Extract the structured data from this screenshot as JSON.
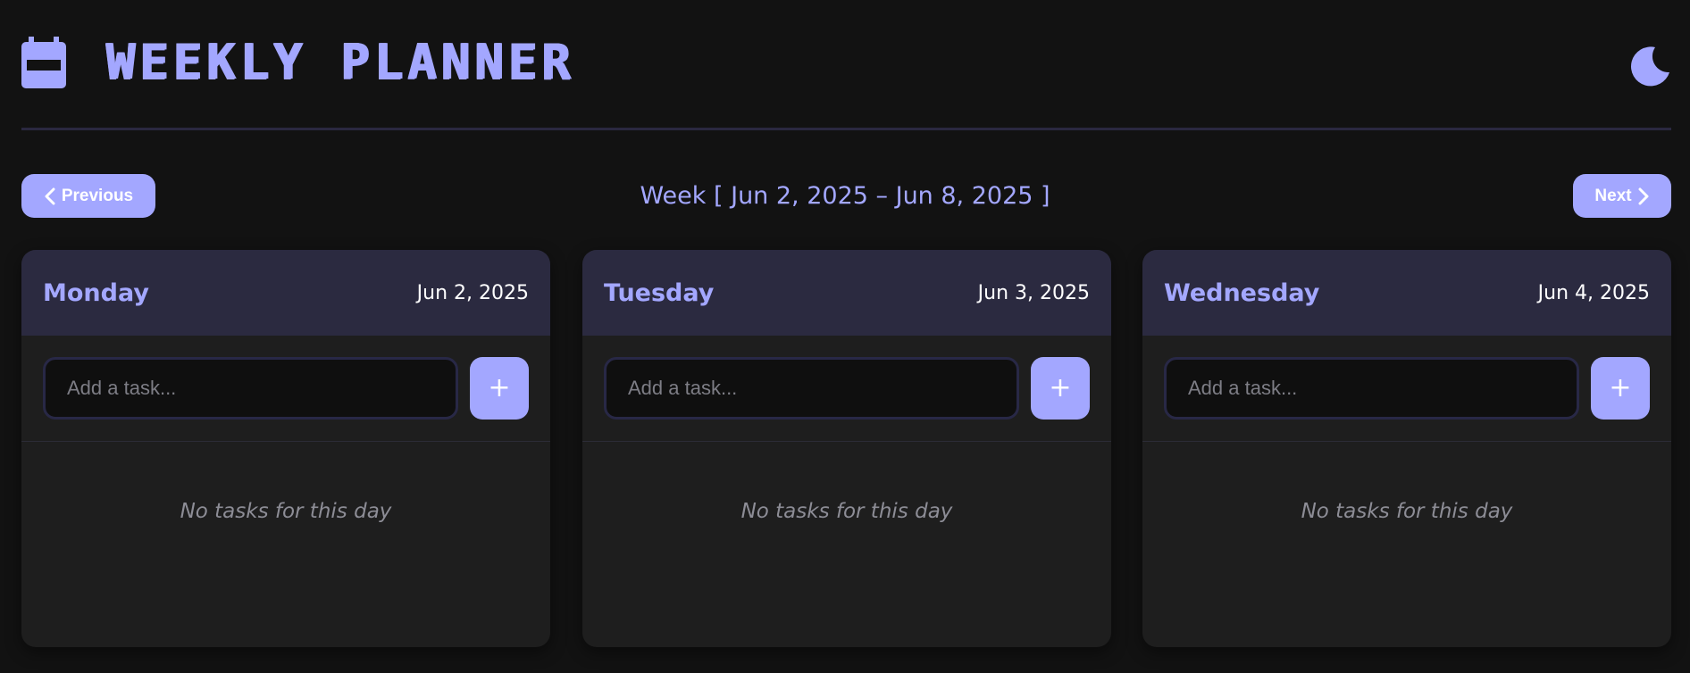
{
  "header": {
    "title": "WEEKLY PLANNER",
    "calendar_icon": "calendar-icon",
    "theme_icon": "moon-icon"
  },
  "nav": {
    "previous_label": "Previous",
    "next_label": "Next",
    "week_label": "Week [ Jun 2, 2025 – Jun 8, 2025 ]"
  },
  "days": [
    {
      "name": "Monday",
      "date": "Jun 2, 2025",
      "placeholder": "Add a task...",
      "add_label": "+",
      "empty_text": "No tasks for this day"
    },
    {
      "name": "Tuesday",
      "date": "Jun 3, 2025",
      "placeholder": "Add a task...",
      "add_label": "+",
      "empty_text": "No tasks for this day"
    },
    {
      "name": "Wednesday",
      "date": "Jun 4, 2025",
      "placeholder": "Add a task...",
      "add_label": "+",
      "empty_text": "No tasks for this day"
    }
  ],
  "colors": {
    "background": "#121212",
    "accent": "#a3a7ff",
    "card": "#1e1e1e",
    "card_header": "#2b2a40",
    "input_bg": "#0f0f0f",
    "divider": "#2a2840"
  }
}
